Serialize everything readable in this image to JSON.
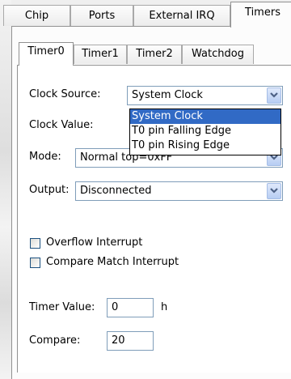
{
  "outer_tabs": [
    {
      "label": "Chip"
    },
    {
      "label": "Ports"
    },
    {
      "label": "External IRQ"
    },
    {
      "label": "Timers"
    }
  ],
  "inner_tabs": [
    {
      "label": "Timer0"
    },
    {
      "label": "Timer1"
    },
    {
      "label": "Timer2"
    },
    {
      "label": "Watchdog"
    }
  ],
  "fields": {
    "clock_source_label": "Clock Source:",
    "clock_source_value": "System Clock",
    "clock_value_label": "Clock Value:",
    "mode_label": "Mode:",
    "mode_value": "Normal top=0xFF",
    "output_label": "Output:",
    "output_value": "Disconnected"
  },
  "dropdown": {
    "options": [
      "System Clock",
      "T0 pin Falling Edge",
      "T0 pin Rising Edge"
    ],
    "selected": "System Clock"
  },
  "checkboxes": [
    {
      "label": "Overflow Interrupt",
      "checked": false
    },
    {
      "label": "Compare Match Interrupt",
      "checked": false
    }
  ],
  "timer_value": {
    "label": "Timer Value:",
    "value": "0",
    "unit": "h"
  },
  "compare": {
    "label": "Compare:",
    "value": "20"
  },
  "colors": {
    "selection": "#316ac5",
    "combo_border": "#7f9db9"
  }
}
